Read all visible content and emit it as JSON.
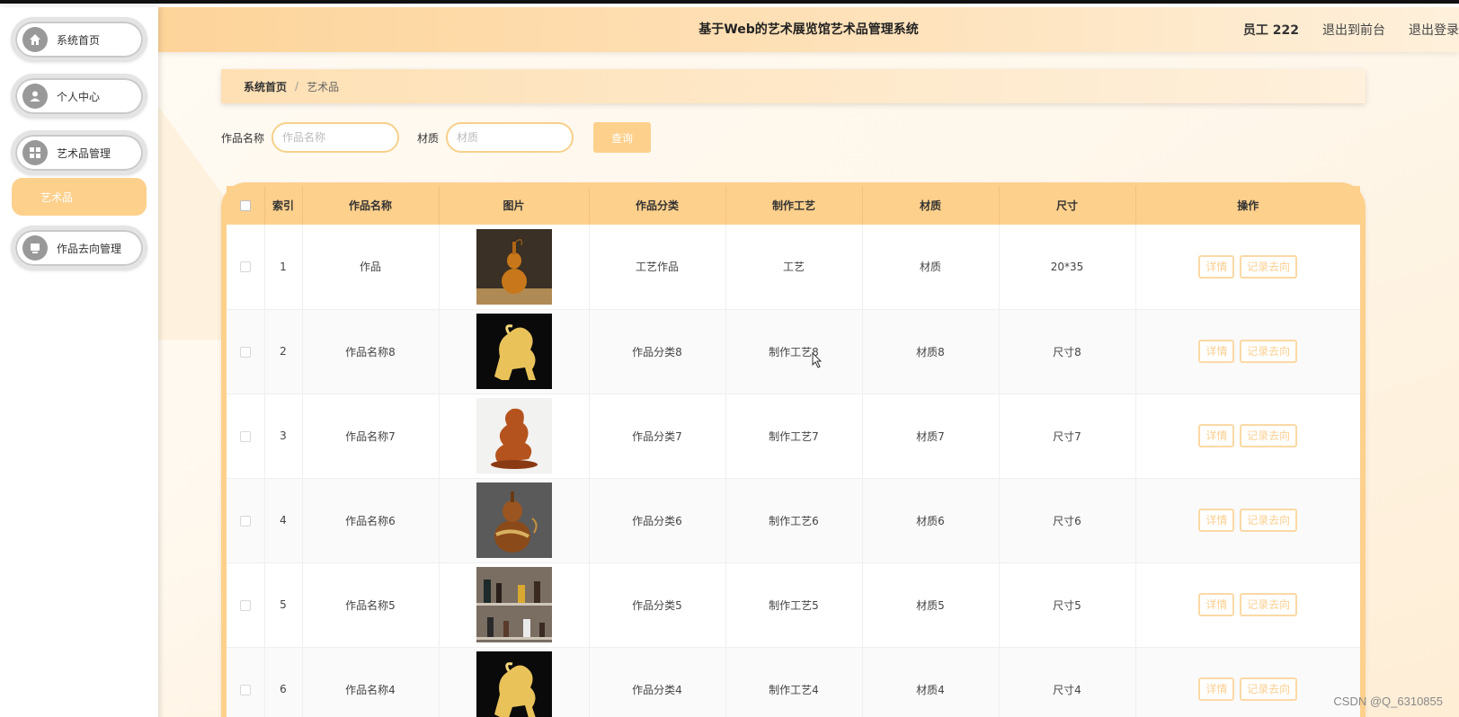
{
  "header": {
    "title": "基于Web的艺术展览馆艺术品管理系统",
    "user": "员工 222",
    "back_front": "退出到前台",
    "logout": "退出登录"
  },
  "sidebar": {
    "items": [
      {
        "label": "系统首页",
        "icon": "home-icon"
      },
      {
        "label": "个人中心",
        "icon": "user-icon"
      },
      {
        "label": "艺术品管理",
        "icon": "grid-icon"
      },
      {
        "label": "艺术品",
        "icon": ""
      },
      {
        "label": "作品去向管理",
        "icon": "card-icon"
      }
    ]
  },
  "breadcrumb": {
    "home": "系统首页",
    "sep": "/",
    "current": "艺术品"
  },
  "search": {
    "name_label": "作品名称",
    "name_placeholder": "作品名称",
    "material_label": "材质",
    "material_placeholder": "材质",
    "query_label": "查询"
  },
  "table": {
    "headers": [
      "索引",
      "作品名称",
      "图片",
      "作品分类",
      "制作工艺",
      "材质",
      "尺寸",
      "操作"
    ],
    "rows": [
      {
        "index": "1",
        "name": "作品",
        "category": "工艺作品",
        "craft": "工艺",
        "material": "材质",
        "size": "20*35",
        "image": "gourd-vase"
      },
      {
        "index": "2",
        "name": "作品名称8",
        "category": "作品分类8",
        "craft": "制作工艺8",
        "material": "材质8",
        "size": "尺寸8",
        "image": "golden-horse"
      },
      {
        "index": "3",
        "name": "作品名称7",
        "category": "作品分类7",
        "craft": "制作工艺7",
        "material": "材质7",
        "size": "尺寸7",
        "image": "dragon-carving"
      },
      {
        "index": "4",
        "name": "作品名称6",
        "category": "作品分类6",
        "craft": "制作工艺6",
        "material": "材质6",
        "size": "尺寸6",
        "image": "painted-gourd"
      },
      {
        "index": "5",
        "name": "作品名称5",
        "category": "作品分类5",
        "craft": "制作工艺5",
        "material": "材质5",
        "size": "尺寸5",
        "image": "display-shelf"
      },
      {
        "index": "6",
        "name": "作品名称4",
        "category": "作品分类4",
        "craft": "制作工艺4",
        "material": "材质4",
        "size": "尺寸4",
        "image": "golden-horse"
      }
    ],
    "detail_label": "详情",
    "record_label": "记录去向"
  },
  "watermark": "CSDN @Q_6310855",
  "colors": {
    "accent": "#fdd08c",
    "header": "#fdd49a",
    "button_text": "#fbcf8f"
  }
}
